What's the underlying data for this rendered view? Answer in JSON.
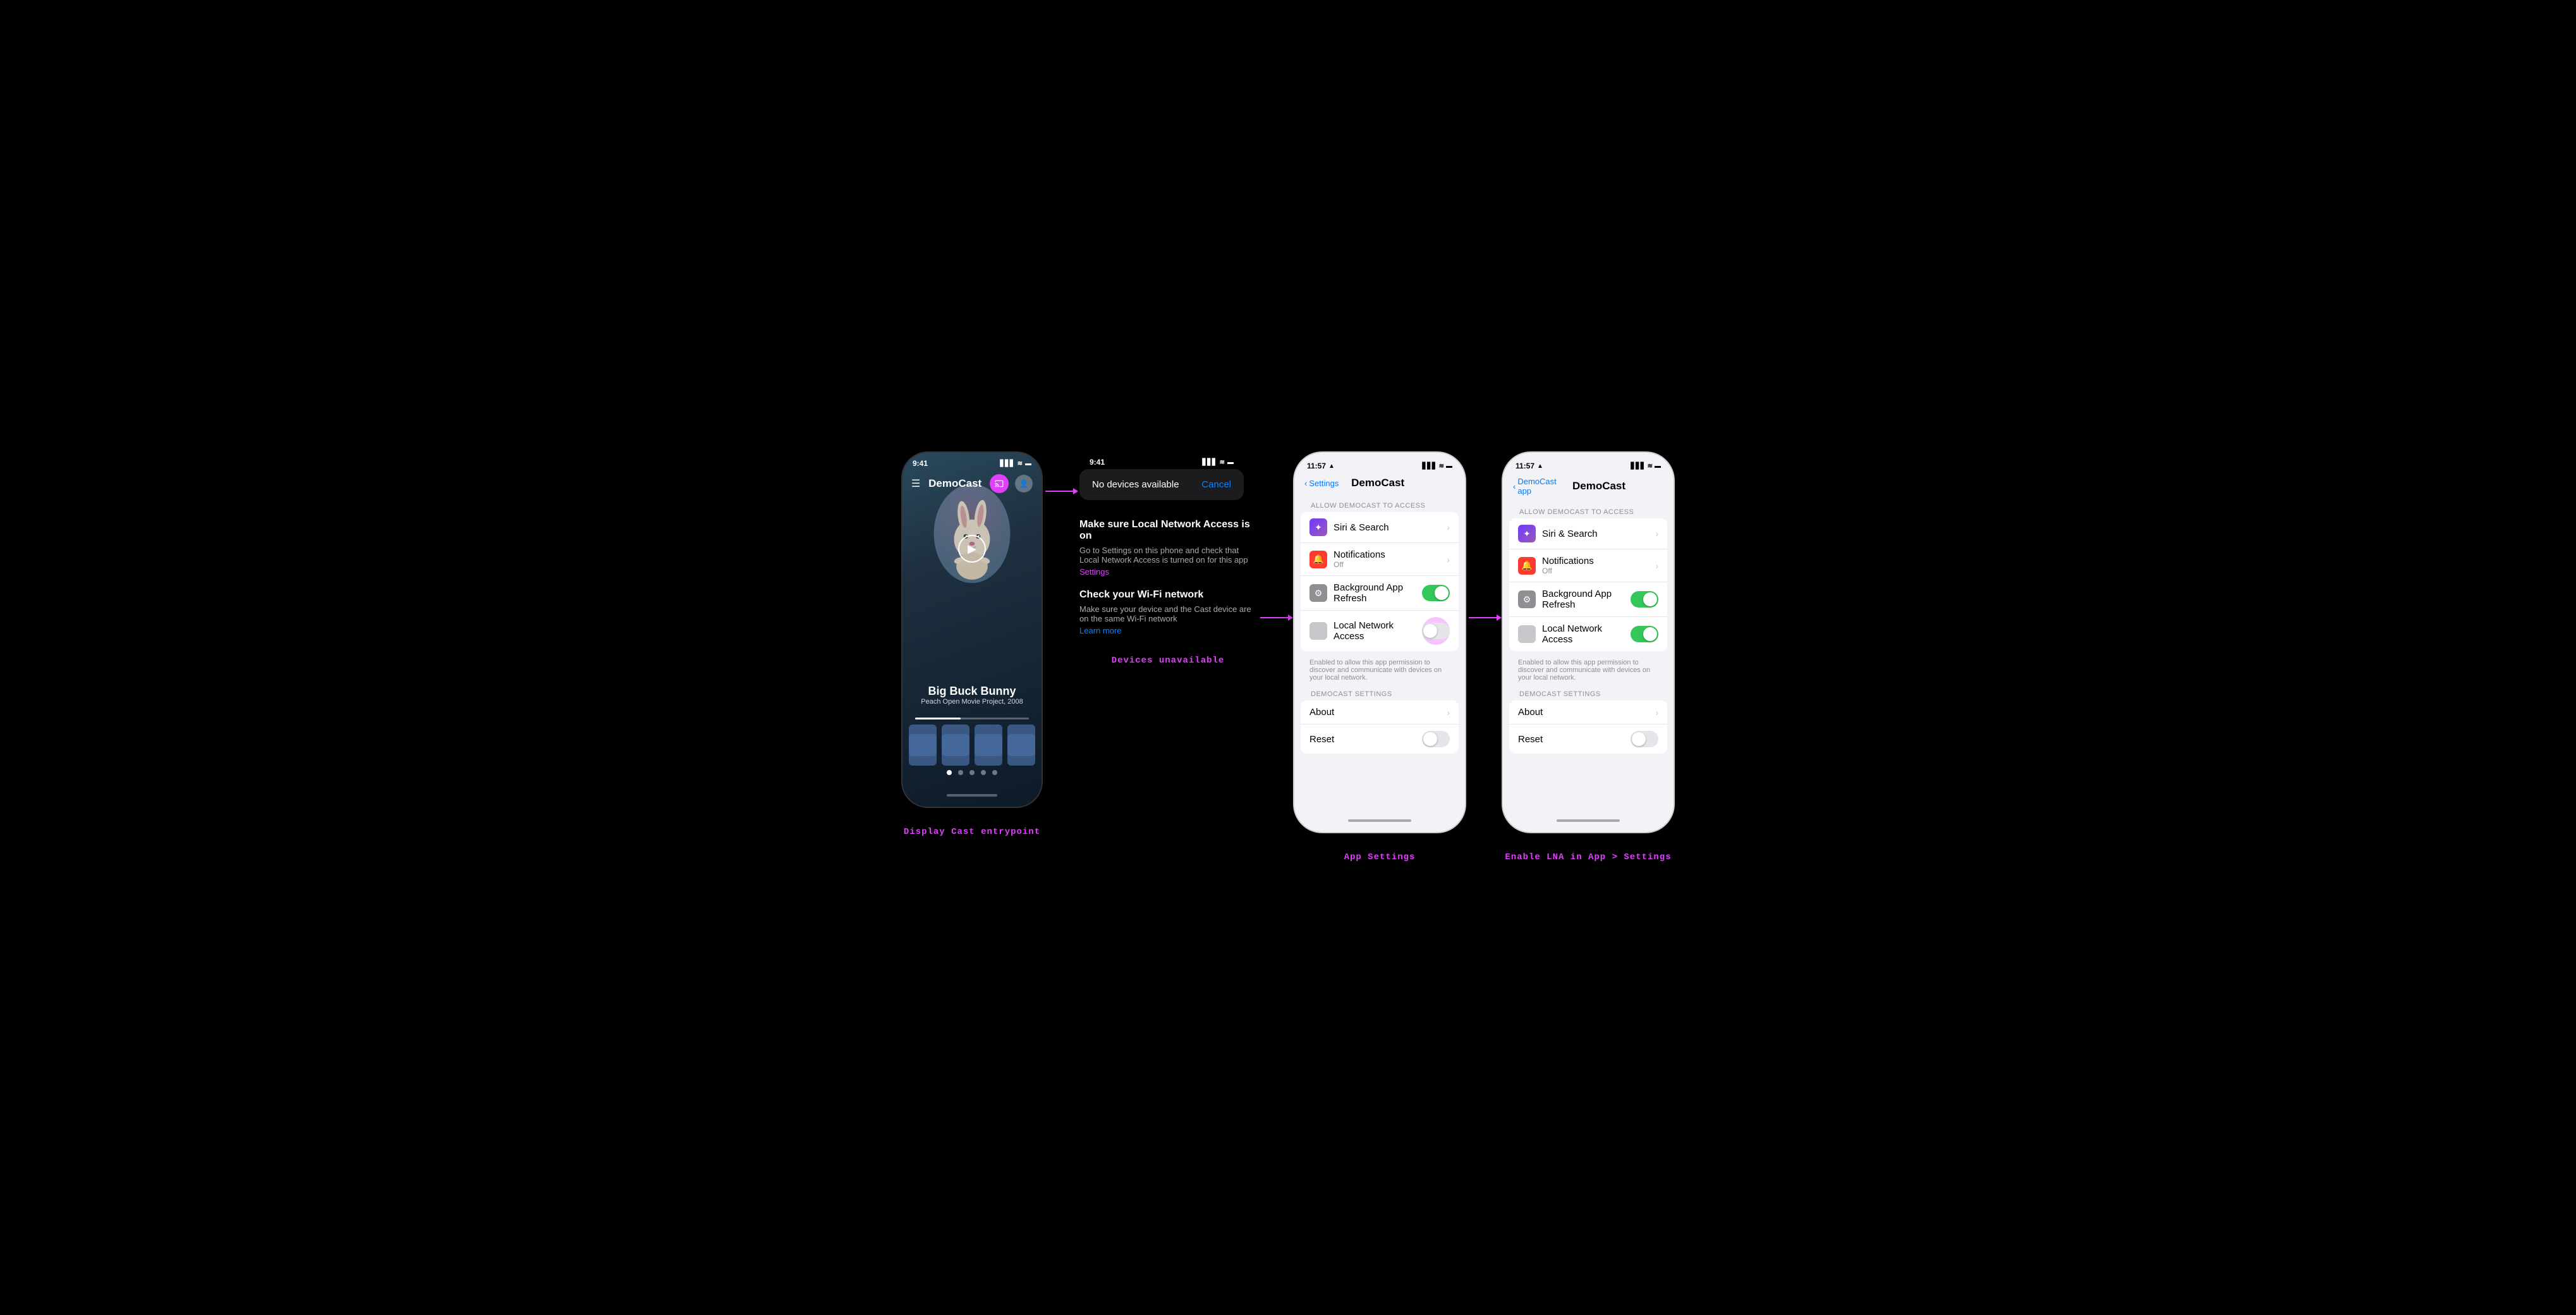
{
  "scene": {
    "background": "#000000"
  },
  "col1": {
    "caption": "Display Cast entrypoint",
    "phone": {
      "status_time": "9:41",
      "status_signal": "▋▋▋",
      "status_wifi": "WiFi",
      "status_battery": "🔋",
      "app_title": "DemoCast",
      "movie_title": "Big Buck Bunny",
      "movie_sub": "Peach Open Movie Project, 2008"
    }
  },
  "col2": {
    "caption": "Devices unavailable",
    "popup": {
      "status_time": "9:41",
      "status_signal": "▋▋▋",
      "status_wifi": "WiFi",
      "status_battery": "🔋",
      "message": "No devices available",
      "cancel": "Cancel"
    },
    "troubleshoot": {
      "title1": "Make sure Local Network Access is on",
      "desc1": "Go to Settings on this phone and check that Local Network Access is turned on for this app",
      "link1": "Settings",
      "title2": "Check your Wi-Fi network",
      "desc2": "Make sure your device and the Cast device are on the same Wi-Fi network",
      "link2": "Learn more"
    }
  },
  "col3": {
    "caption": "App Settings",
    "phone": {
      "status_time": "11:57",
      "status_location": "◀",
      "back_label": "Settings",
      "nav_title": "DemoCast",
      "section1_header": "ALLOW DEMOCAST TO ACCESS",
      "rows": [
        {
          "label": "Siri & Search",
          "sublabel": "",
          "icon": "siri",
          "type": "chevron"
        },
        {
          "label": "Notifications",
          "sublabel": "Off",
          "icon": "notif",
          "type": "chevron"
        },
        {
          "label": "Background App Refresh",
          "sublabel": "",
          "icon": "refresh",
          "type": "toggle_on"
        },
        {
          "label": "Local Network Access",
          "sublabel": "",
          "icon": "network",
          "type": "toggle_off_highlight"
        }
      ],
      "lna_description": "Enabled to allow this app permission to discover and communicate with devices on your local network.",
      "section2_header": "DEMOCAST SETTINGS",
      "rows2": [
        {
          "label": "About",
          "sublabel": "",
          "type": "chevron"
        },
        {
          "label": "Reset",
          "sublabel": "",
          "type": "toggle_off"
        }
      ]
    }
  },
  "col4": {
    "caption": "Enable LNA in App > Settings",
    "phone": {
      "status_time": "11:57",
      "back_label": "DemoCast app",
      "nav_title": "DemoCast",
      "section1_header": "ALLOW DEMOCAST TO ACCESS",
      "rows": [
        {
          "label": "Siri & Search",
          "sublabel": "",
          "icon": "siri",
          "type": "chevron"
        },
        {
          "label": "Notifications",
          "sublabel": "Off",
          "icon": "notif",
          "type": "chevron"
        },
        {
          "label": "Background App Refresh",
          "sublabel": "",
          "icon": "refresh",
          "type": "toggle_on"
        },
        {
          "label": "Local Network Access",
          "sublabel": "",
          "icon": "network",
          "type": "toggle_on"
        }
      ],
      "lna_description": "Enabled to allow this app permission to discover and communicate with devices on your local network.",
      "section2_header": "DEMOCAST SETTINGS",
      "rows2": [
        {
          "label": "About",
          "sublabel": "",
          "type": "chevron"
        },
        {
          "label": "Reset",
          "sublabel": "",
          "type": "toggle_off"
        }
      ]
    }
  },
  "arrows": {
    "arrow1": "→",
    "arrow2": "→"
  }
}
